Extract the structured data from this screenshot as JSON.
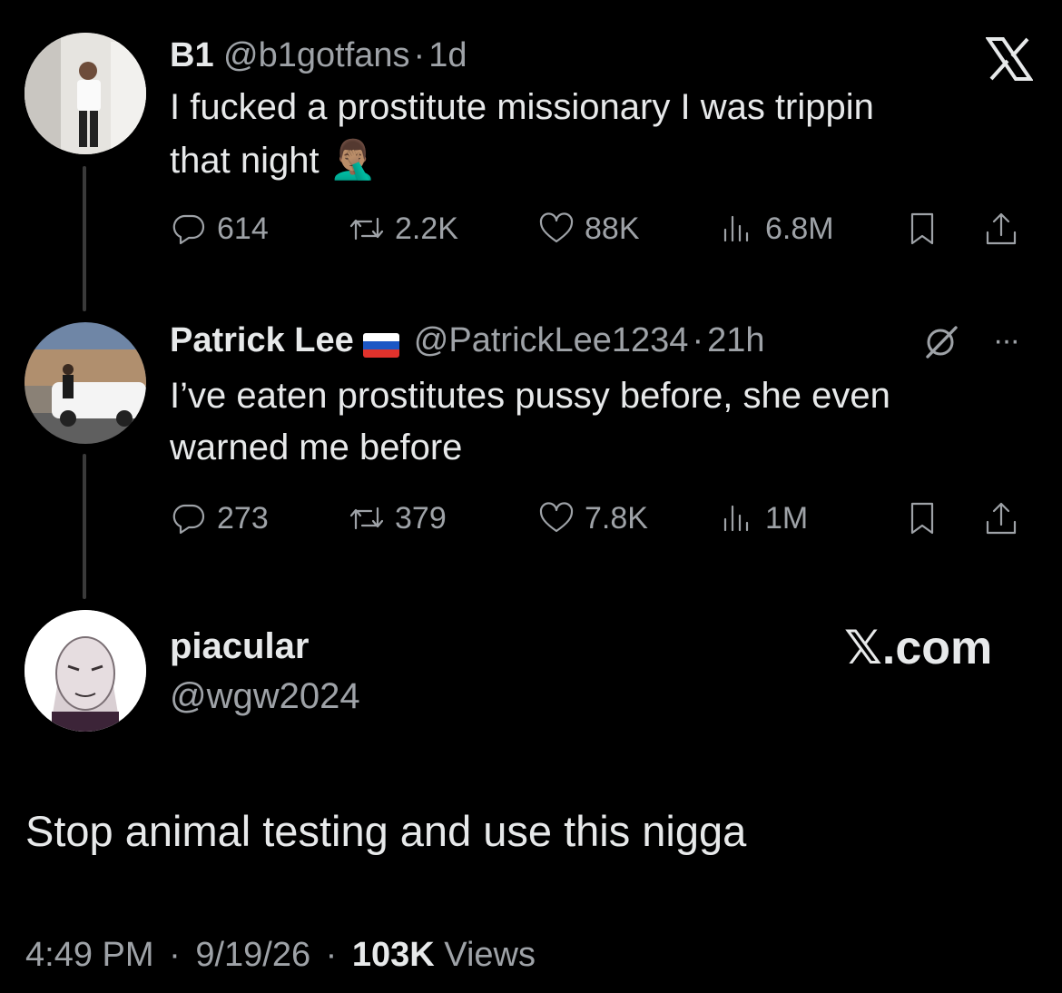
{
  "tweet1": {
    "name": "B1",
    "handle": "@b1gotfans",
    "sep": "·",
    "time": "1d",
    "text_line1": "I fucked a prostitute missionary I was trippin",
    "text_line2": "that night",
    "emoji": "🤦🏽‍♂️",
    "replies": "614",
    "retweets": "2.2K",
    "likes": "88K",
    "views": "6.8M"
  },
  "tweet2": {
    "name": "Patrick Lee",
    "handle": "@PatrickLee1234",
    "sep": "·",
    "time": "21h",
    "text_line1": "I’ve eaten prostitutes pussy before, she even",
    "text_line2": "warned me before",
    "replies": "273",
    "retweets": "379",
    "likes": "7.8K",
    "views": "1M",
    "more": "···"
  },
  "post": {
    "name": "piacular",
    "handle": "@wgw2024",
    "brand": "𝕏.com",
    "text": "Stop animal testing and use this nigga",
    "time": "4:49 PM",
    "sep": "·",
    "date": "9/19/26",
    "sep2": "·",
    "views_count": "103K",
    "views_label": "Views"
  },
  "icons": {
    "reply": "reply-icon",
    "retweet": "retweet-icon",
    "like": "heart-icon",
    "views": "views-icon",
    "bookmark": "bookmark-icon",
    "share": "share-icon",
    "x_logo": "x-logo-icon",
    "grok": "grok-icon"
  },
  "colors": {
    "background": "#000000",
    "text": "#e7e9ea",
    "muted": "#9ea2a7",
    "line": "#3a3a3a"
  }
}
